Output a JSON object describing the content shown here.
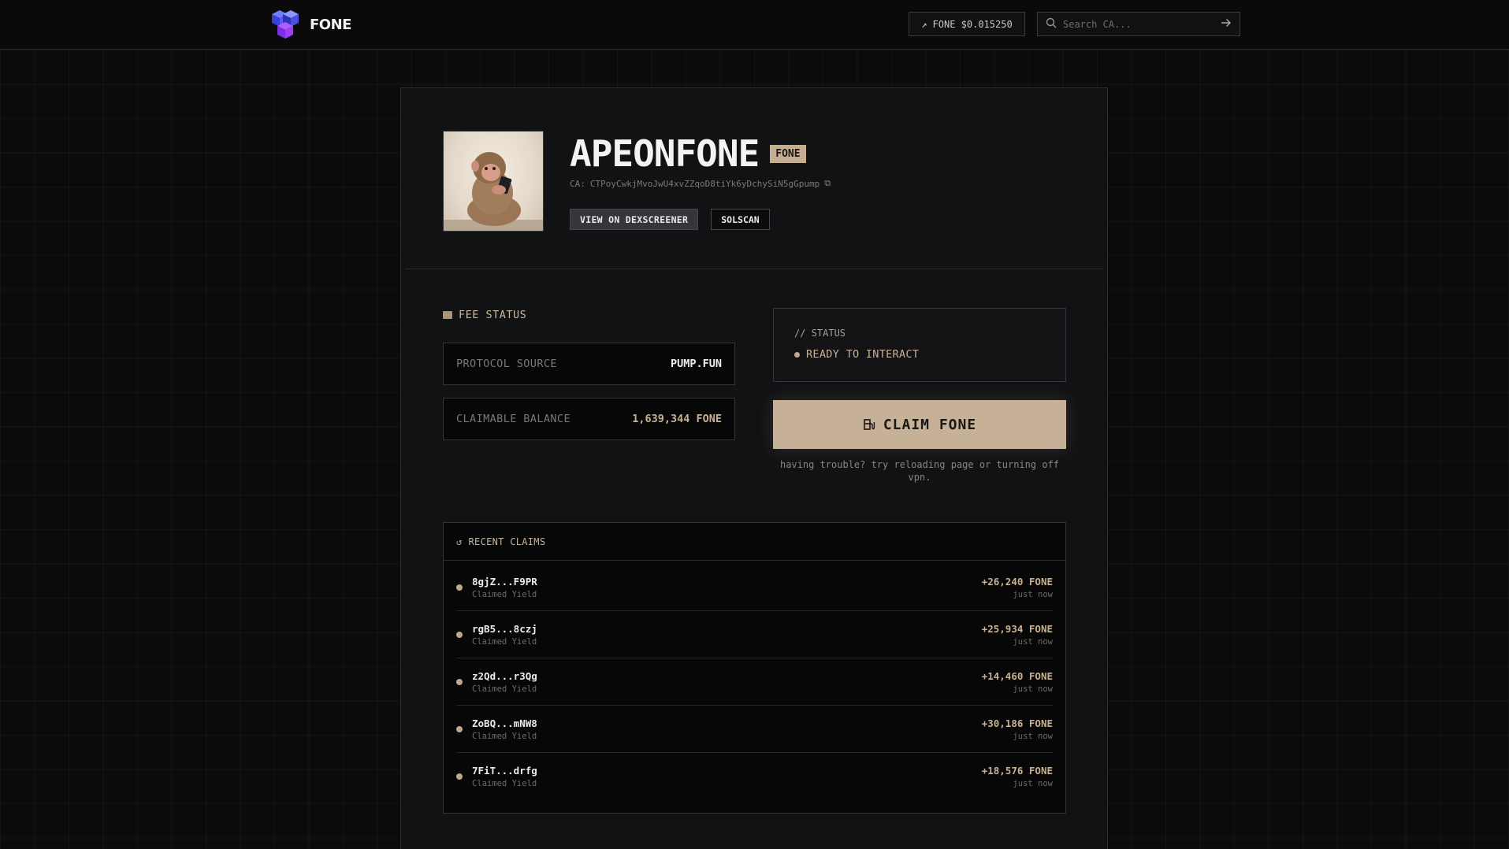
{
  "header": {
    "brand": "FONE",
    "price_label": "FONE $0.015250",
    "search_placeholder": "Search CA..."
  },
  "token": {
    "name": "APEONFONE",
    "ticker": "FONE",
    "ca_label": "CA:",
    "ca": "CTPoyCwkjMvoJwU4xvZZqoD8tiYk6yDchySiN5gGpump",
    "dex_label": "VIEW ON DEXSCREENER",
    "solscan_label": "SOLSCAN"
  },
  "fee_status": {
    "title": "FEE STATUS",
    "protocol_label": "PROTOCOL SOURCE",
    "protocol_value": "PUMP.FUN",
    "balance_label": "CLAIMABLE BALANCE",
    "balance_value": "1,639,344 FONE"
  },
  "status": {
    "label": "// STATUS",
    "value": "READY TO INTERACT"
  },
  "claim": {
    "button_label": "CLAIM FONE",
    "hint": "having trouble? try reloading page or turning off vpn."
  },
  "recent_claims": {
    "title": "RECENT CLAIMS",
    "rows": [
      {
        "addr": "8gjZ...F9PR",
        "sub": "Claimed Yield",
        "amount": "+26,240 FONE",
        "time": "just now"
      },
      {
        "addr": "rgB5...8czj",
        "sub": "Claimed Yield",
        "amount": "+25,934 FONE",
        "time": "just now"
      },
      {
        "addr": "z2Qd...r3Qg",
        "sub": "Claimed Yield",
        "amount": "+14,460 FONE",
        "time": "just now"
      },
      {
        "addr": "ZoBQ...mNW8",
        "sub": "Claimed Yield",
        "amount": "+30,186 FONE",
        "time": "just now"
      },
      {
        "addr": "7FiT...drfg",
        "sub": "Claimed Yield",
        "amount": "+18,576 FONE",
        "time": "just now"
      }
    ]
  },
  "colors": {
    "accent": "#c6b097",
    "background": "#0b0b0c",
    "card": "#111214"
  }
}
